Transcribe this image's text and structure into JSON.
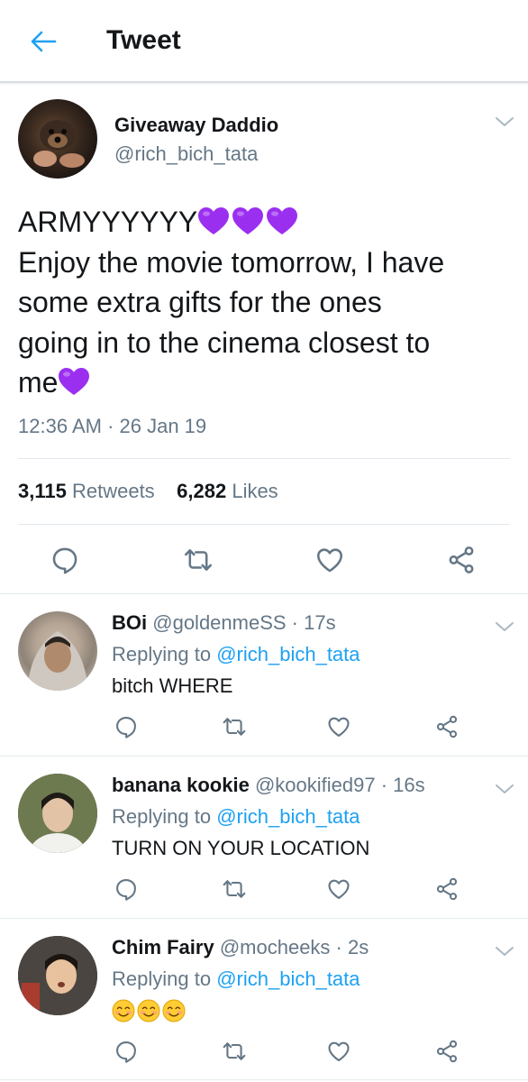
{
  "header": {
    "title": "Tweet",
    "back_icon": "arrow-left-icon"
  },
  "colors": {
    "accent": "#1da1f2",
    "text": "#14171a",
    "muted": "#657786",
    "divider": "#e1e8ed",
    "heart_emoji": "#9b2ff0"
  },
  "main_tweet": {
    "author_name": "Giveaway Daddio",
    "author_handle": "@rich_bich_tata",
    "text_lines": [
      "ARMYYYYYY",
      "Enjoy the movie tomorrow, I have",
      "some extra gifts for the ones",
      "going in to the cinema closest to",
      "me"
    ],
    "emoji": [
      "purple-heart",
      "purple-heart",
      "purple-heart",
      "purple-heart"
    ],
    "timestamp": "12:36 AM · 26 Jan 19",
    "retweets_count": "3,115",
    "retweets_label": "Retweets",
    "likes_count": "6,282",
    "likes_label": "Likes"
  },
  "replies": [
    {
      "name": "BOi",
      "meta": "@goldenmeSS · 17s",
      "replying_prefix": "Replying to",
      "replying_handle": "@rich_bich_tata",
      "text": "bitch WHERE"
    },
    {
      "name": "banana kookie",
      "meta": "@kookified97 · 16s",
      "replying_prefix": "Replying to",
      "replying_handle": "@rich_bich_tata",
      "text": "TURN ON YOUR LOCATION"
    },
    {
      "name": "Chim Fairy",
      "meta": "@mocheeks · 2s",
      "replying_prefix": "Replying to",
      "replying_handle": "@rich_bich_tata",
      "text": "",
      "emoji": [
        "smiling-face",
        "smiling-face",
        "smiling-face"
      ]
    }
  ],
  "action_icons": [
    "reply-icon",
    "retweet-icon",
    "like-icon",
    "share-icon"
  ]
}
